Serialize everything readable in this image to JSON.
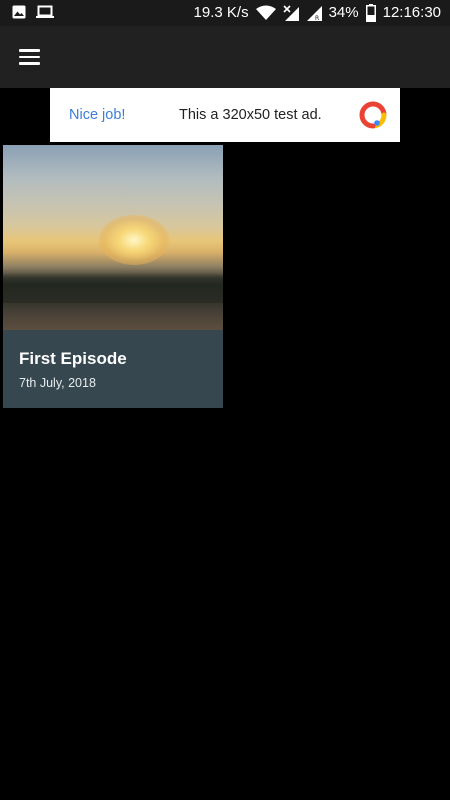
{
  "status_bar": {
    "network_speed": "19.3 K/s",
    "battery_percent": "34%",
    "time": "12:16:30",
    "icons": [
      "image-icon",
      "laptop-icon",
      "wifi-icon",
      "signal-no-service-icon",
      "signal-roaming-icon",
      "battery-icon"
    ]
  },
  "app_bar": {
    "menu_icon": "hamburger-menu-icon"
  },
  "ad": {
    "left_text": "Nice job!",
    "main_text": "This a 320x50 test ad.",
    "logo": "ad-logo-icon"
  },
  "episodes": [
    {
      "title": "First Episode",
      "date": "7th July, 2018",
      "thumbnail": "sunset-landscape-image"
    }
  ],
  "colors": {
    "background": "#000000",
    "app_bar": "#212121",
    "card_footer": "#37474f",
    "ad_link": "#3b7dd8"
  }
}
